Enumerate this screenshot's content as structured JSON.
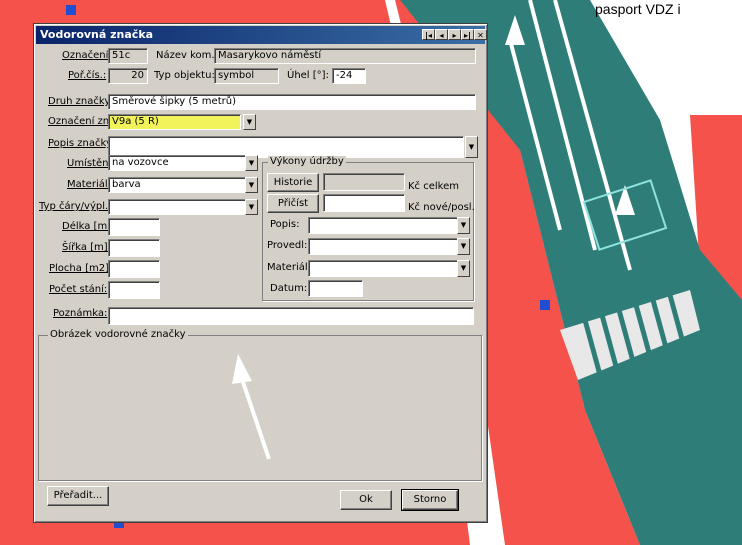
{
  "colors": {
    "map_red": "#f4524a",
    "map_teal": "#2f7d78",
    "dialog_bg": "#d4d0c8",
    "title_bg": "#0a246a",
    "highlight": "#f2f25a"
  },
  "header_fragment": "pasport VDZ i",
  "dialog": {
    "title": "Vodorovná značka",
    "title_buttons": [
      "|◂",
      "◂",
      "▸",
      "▸|",
      "✕"
    ],
    "oznaceni_label": "Označení:",
    "oznaceni_value": "51c",
    "nazev_label": "Název kom.:",
    "nazev_value": "Masarykovo náměstí",
    "por_cis_label": "Poř.čís.:",
    "por_cis_value": "20",
    "typ_label": "Typ objektu:",
    "typ_value": "symbol",
    "uhel_label": "Úhel [°]:",
    "uhel_value": "-24",
    "druh_label": "Druh značky:",
    "druh_value": "Směrové šipky (5 metrů)",
    "oznaceni_zn_label": "Označení zn.:",
    "oznaceni_zn_value": "V9a (5 R)",
    "popis_label": "Popis značky:",
    "popis_value": "",
    "umisteni_label": "Umístění:",
    "umisteni_value": "na vozovce",
    "material_label": "Materiál:",
    "material_value": "barva",
    "typ_cary_label": "Typ čáry/výpl.:",
    "typ_cary_value": "",
    "delka_label": "Délka [m]:",
    "sirka_label": "Šířka [m]:",
    "plocha_label": "Plocha [m2]:",
    "pocet_label": "Počet stání:",
    "poznamka_label": "Poznámka:",
    "vykony_title": "Výkony údržby",
    "historie_btn": "Historie",
    "kc_celkem": "Kč celkem",
    "pricist_btn": "Přičíst",
    "kc_nove": "Kč nové/posl.",
    "v_popis_label": "Popis:",
    "v_proved_label": "Provedl:",
    "v_material_label": "Materiál:",
    "v_datum_label": "Datum:",
    "obrazek_title": "Obrázek vodorovné značky",
    "prerad_btn": "Přeřadit...",
    "ok_btn": "Ok",
    "storno_btn": "Storno"
  }
}
